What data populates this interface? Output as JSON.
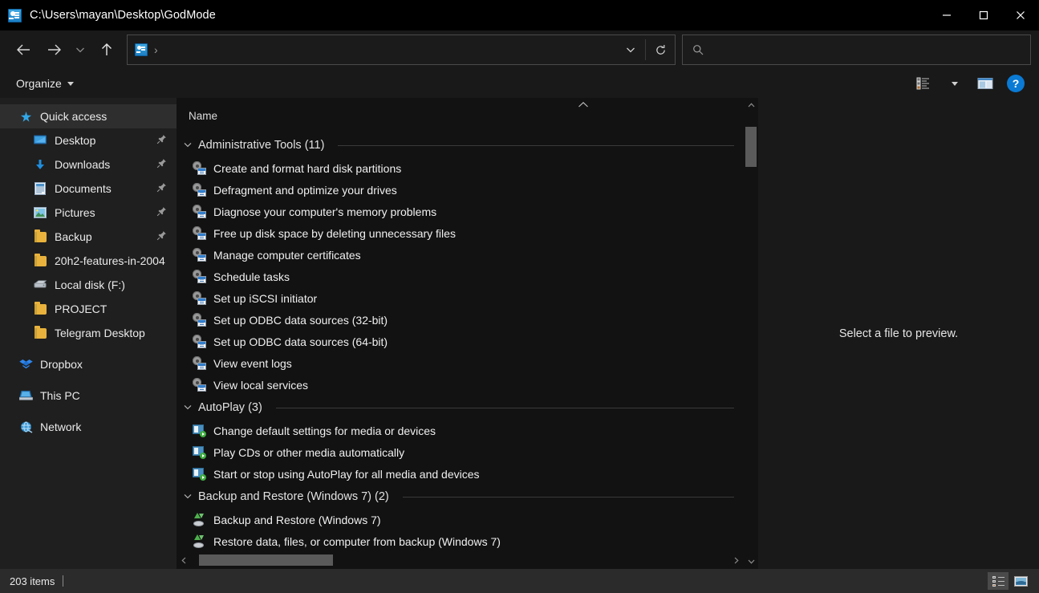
{
  "window": {
    "title": "C:\\Users\\mayan\\Desktop\\GodMode",
    "title_icon": "godmode-icon",
    "minimize_label": "Minimize",
    "maximize_label": "Maximize",
    "close_label": "Close"
  },
  "addressbar": {
    "icon": "godmode-icon",
    "crumb_separator": "›",
    "value": "",
    "history_dropdown": "history-dropdown-icon",
    "refresh": "refresh-icon",
    "back": "back-arrow-icon",
    "forward": "forward-arrow-icon",
    "recent": "recent-locations-icon",
    "up": "up-arrow-icon"
  },
  "search": {
    "icon": "search-icon",
    "placeholder": "",
    "value": ""
  },
  "toolbar": {
    "organize_label": "Organize",
    "view_options_icon": "view-options-icon",
    "view_dropdown_icon": "chevron-down-icon",
    "preview_pane_icon": "preview-pane-icon",
    "help_label": "?"
  },
  "sidebar": {
    "items": [
      {
        "label": "Quick access",
        "icon": "star-icon",
        "level": 0,
        "selected": true,
        "pinned": false
      },
      {
        "label": "Desktop",
        "icon": "desktop-icon",
        "level": 1,
        "selected": false,
        "pinned": true
      },
      {
        "label": "Downloads",
        "icon": "download-icon",
        "level": 1,
        "selected": false,
        "pinned": true
      },
      {
        "label": "Documents",
        "icon": "documents-icon",
        "level": 1,
        "selected": false,
        "pinned": true
      },
      {
        "label": "Pictures",
        "icon": "pictures-icon",
        "level": 1,
        "selected": false,
        "pinned": true
      },
      {
        "label": "Backup",
        "icon": "folder-icon",
        "level": 1,
        "selected": false,
        "pinned": true
      },
      {
        "label": "20h2-features-in-2004",
        "icon": "folder-icon",
        "level": 1,
        "selected": false,
        "pinned": false
      },
      {
        "label": "Local disk (F:)",
        "icon": "drive-icon",
        "level": 1,
        "selected": false,
        "pinned": false
      },
      {
        "label": "PROJECT",
        "icon": "folder-icon",
        "level": 1,
        "selected": false,
        "pinned": false
      },
      {
        "label": "Telegram Desktop",
        "icon": "folder-icon",
        "level": 1,
        "selected": false,
        "pinned": false
      },
      {
        "label": "Dropbox",
        "icon": "dropbox-icon",
        "level": 0,
        "selected": false,
        "pinned": false,
        "gap": true
      },
      {
        "label": "This PC",
        "icon": "this-pc-icon",
        "level": 0,
        "selected": false,
        "pinned": false,
        "gap": true
      },
      {
        "label": "Network",
        "icon": "network-icon",
        "level": 0,
        "selected": false,
        "pinned": false,
        "gap": true
      }
    ],
    "pin_icon": "pin-icon"
  },
  "filelist": {
    "column_header": "Name",
    "sort_indicator": "chevron-up-icon",
    "groups": [
      {
        "title": "Administrative Tools (11)",
        "icon_kind": "admin",
        "items": [
          "Create and format hard disk partitions",
          "Defragment and optimize your drives",
          "Diagnose your computer's memory problems",
          "Free up disk space by deleting unnecessary files",
          "Manage computer certificates",
          "Schedule tasks",
          "Set up iSCSI initiator",
          "Set up ODBC data sources (32-bit)",
          "Set up ODBC data sources (64-bit)",
          "View event logs",
          "View local services"
        ]
      },
      {
        "title": "AutoPlay (3)",
        "icon_kind": "autoplay",
        "items": [
          "Change default settings for media or devices",
          "Play CDs or other media automatically",
          "Start or stop using AutoPlay for all media and devices"
        ]
      },
      {
        "title": "Backup and Restore (Windows 7) (2)",
        "icon_kind": "backup",
        "items": [
          "Backup and Restore (Windows 7)",
          "Restore data, files, or computer from backup (Windows 7)"
        ]
      }
    ]
  },
  "preview": {
    "message": "Select a file to preview."
  },
  "status": {
    "item_count": "203 items",
    "details_view_icon": "details-view-icon",
    "large_icons_view_icon": "large-icons-view-icon",
    "active_view": "details"
  },
  "colors": {
    "window_bg": "#191919",
    "titlebar_bg": "#000000",
    "sidebar_bg": "#1f1f1f",
    "list_bg": "#121212",
    "status_bg": "#2b2b2b",
    "accent": "#0a7ad4",
    "selection": "#2e2e2e",
    "text": "#f0f0f0"
  }
}
